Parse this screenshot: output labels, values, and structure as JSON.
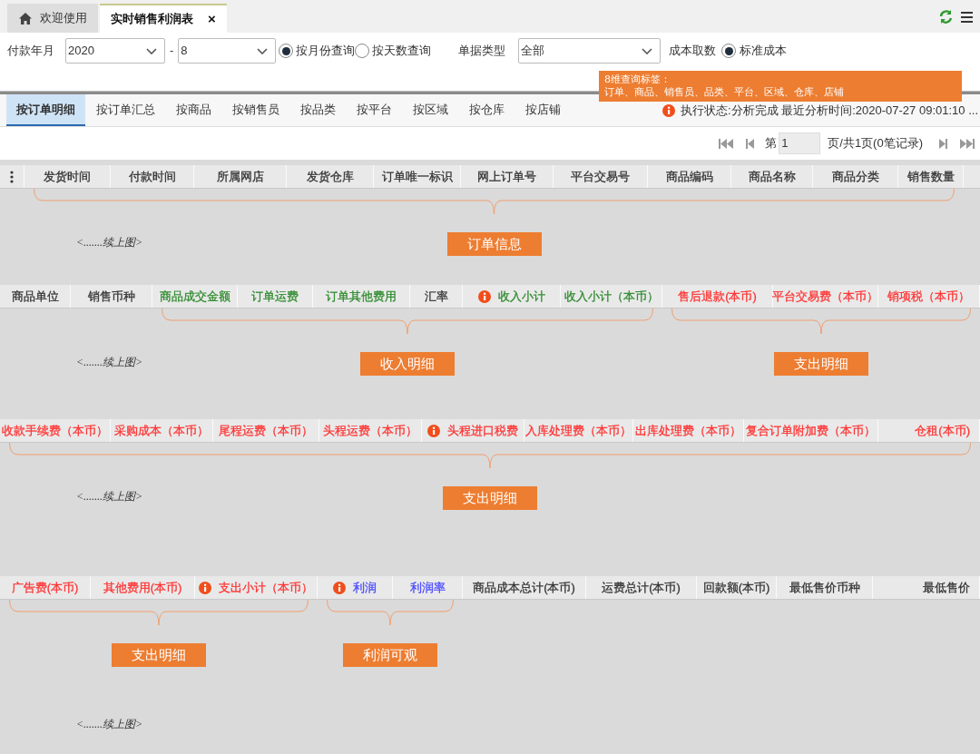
{
  "window_tabs": [
    {
      "label": "欢迎使用",
      "kind": "home",
      "selected": false
    },
    {
      "label": "实时销售利润表",
      "kind": "report",
      "selected": true,
      "close": "×"
    }
  ],
  "filters": {
    "payment_month": {
      "label": "付款年月",
      "year": "2020",
      "separator": "-",
      "month": "8"
    },
    "query_modes": [
      {
        "label": "按月份查询",
        "selected": true
      },
      {
        "label": "按天数查询",
        "selected": false
      }
    ],
    "document_type": {
      "label": "单据类型",
      "value": "全部"
    },
    "cost_source": {
      "label": "成本取数",
      "options": [
        {
          "label": "标准成本",
          "selected": true
        }
      ]
    }
  },
  "tooltip": {
    "title": "8维查询标签：",
    "body": "订单、商品、销售员、品类、平台、区域、仓库、店铺"
  },
  "view_tabs": [
    {
      "label": "按订单明细",
      "selected": true
    },
    {
      "label": "按订单汇总",
      "selected": false
    },
    {
      "label": "按商品",
      "selected": false
    },
    {
      "label": "按销售员",
      "selected": false
    },
    {
      "label": "按品类",
      "selected": false
    },
    {
      "label": "按平台",
      "selected": false
    },
    {
      "label": "按区域",
      "selected": false
    },
    {
      "label": "按仓库",
      "selected": false
    },
    {
      "label": "按店铺",
      "selected": false
    }
  ],
  "status": "执行状态:分析完成 最近分析时间:2020-07-27 09:01:10 ...",
  "pager": {
    "prefix": "第",
    "page": "1",
    "suffix": "页/共1页(0笔记录)"
  },
  "sections": [
    {
      "note": "<.......续上图>",
      "groups": [
        {
          "columns": [
            {
              "kind": "menu"
            }
          ]
        },
        {
          "label": "订单信息",
          "columns": [
            {
              "kind": "text",
              "label": "发货时间",
              "color": "#333333",
              "info": false
            },
            {
              "kind": "text",
              "label": "付款时间",
              "color": "#333333",
              "info": false
            },
            {
              "kind": "text",
              "label": "所属网店",
              "color": "#333333",
              "info": false
            },
            {
              "kind": "text",
              "label": "发货仓库",
              "color": "#333333",
              "info": false
            },
            {
              "kind": "text",
              "label": "订单唯一标识",
              "color": "#333333",
              "info": false
            },
            {
              "kind": "text",
              "label": "网上订单号",
              "color": "#333333",
              "info": false
            },
            {
              "kind": "text",
              "label": "平台交易号",
              "color": "#333333",
              "info": false
            },
            {
              "kind": "text",
              "label": "商品编码",
              "color": "#333333",
              "info": false
            },
            {
              "kind": "text",
              "label": "商品名称",
              "color": "#333333",
              "info": false
            },
            {
              "kind": "text",
              "label": "商品分类",
              "color": "#333333",
              "info": false
            },
            {
              "kind": "text",
              "label": "销售数量",
              "color": "#333333",
              "info": false
            }
          ]
        }
      ]
    },
    {
      "note": "<.......续上图>",
      "groups": [
        {
          "columns": [
            {
              "kind": "text",
              "label": "商品单位",
              "color": "#333333",
              "info": false
            },
            {
              "kind": "text",
              "label": "销售币种",
              "color": "#333333",
              "info": false
            }
          ]
        },
        {
          "label": "收入明细",
          "columns": [
            {
              "kind": "text",
              "label": "商品成交金额",
              "color": "#2e8b2e",
              "info": false
            },
            {
              "kind": "text",
              "label": "订单运费",
              "color": "#2e8b2e",
              "info": false
            },
            {
              "kind": "text",
              "label": "订单其他费用",
              "color": "#2e8b2e",
              "info": false
            },
            {
              "kind": "text",
              "label": "汇率",
              "color": "#333333",
              "info": false
            },
            {
              "kind": "text",
              "label": "收入小计",
              "color": "#2e8b2e",
              "info": true
            },
            {
              "kind": "text",
              "label": "收入小计（本币）",
              "color": "#2e8b2e",
              "info": false
            }
          ]
        },
        {
          "label": "支出明细",
          "columns": [
            {
              "kind": "text",
              "label": "售后退款(本币)",
              "color": "#ff3333",
              "info": false
            },
            {
              "kind": "text",
              "label": "平台交易费（本币）",
              "color": "#ff3333",
              "info": false
            },
            {
              "kind": "text",
              "label": "销项税（本币）",
              "color": "#ff3333",
              "info": false
            }
          ]
        }
      ]
    },
    {
      "note": "<.......续上图>",
      "groups": [
        {
          "label": "支出明细",
          "columns": [
            {
              "kind": "text",
              "label": "收款手续费（本币）",
              "color": "#ff3333",
              "info": false
            },
            {
              "kind": "text",
              "label": "采购成本（本币）",
              "color": "#ff3333",
              "info": false
            },
            {
              "kind": "text",
              "label": "尾程运费（本币）",
              "color": "#ff3333",
              "info": false
            },
            {
              "kind": "text",
              "label": "头程运费（本币）",
              "color": "#ff3333",
              "info": false
            },
            {
              "kind": "text",
              "label": "头程进口税费",
              "color": "#ff3333",
              "info": true
            },
            {
              "kind": "text",
              "label": "入库处理费（本币）",
              "color": "#ff3333",
              "info": false
            },
            {
              "kind": "text",
              "label": "出库处理费（本币）",
              "color": "#ff3333",
              "info": false
            },
            {
              "kind": "text",
              "label": "复合订单附加费（本币）",
              "color": "#ff3333",
              "info": false
            },
            {
              "kind": "text",
              "label": "仓租(本币)",
              "color": "#ff3333",
              "info": false
            }
          ]
        }
      ]
    },
    {
      "note": "<.......续上图>",
      "groups": [
        {
          "label": "支出明细",
          "columns": [
            {
              "kind": "text",
              "label": "广告费(本币)",
              "color": "#ff3333",
              "info": false
            },
            {
              "kind": "text",
              "label": "其他费用(本币)",
              "color": "#ff3333",
              "info": false
            },
            {
              "kind": "text",
              "label": "支出小计（本币）",
              "color": "#ff3333",
              "info": true
            }
          ]
        },
        {
          "label": "利润可观",
          "columns": [
            {
              "kind": "text",
              "label": "利润",
              "color": "#4b4bff",
              "info": true
            },
            {
              "kind": "text",
              "label": "利润率",
              "color": "#4b4bff",
              "info": false
            }
          ]
        },
        {
          "columns": [
            {
              "kind": "text",
              "label": "商品成本总计(本币)",
              "color": "#333333",
              "info": false
            },
            {
              "kind": "text",
              "label": "运费总计(本币)",
              "color": "#333333",
              "info": false
            },
            {
              "kind": "text",
              "label": "回款额(本币)",
              "color": "#333333",
              "info": false
            },
            {
              "kind": "text",
              "label": "最低售价币种",
              "color": "#333333",
              "info": false
            },
            {
              "kind": "text",
              "label": "最低售价",
              "color": "#333333",
              "info": false
            }
          ]
        }
      ]
    }
  ]
}
